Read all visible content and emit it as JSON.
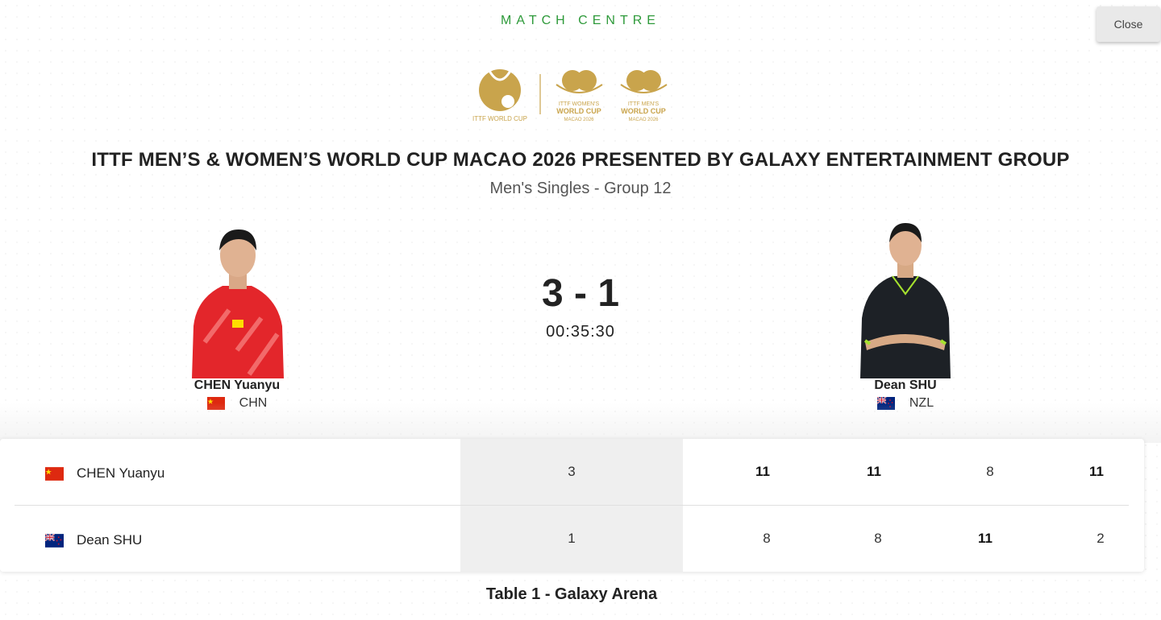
{
  "header": {
    "eyebrow": "MATCH CENTRE",
    "close_label": "Close"
  },
  "logos": {
    "logo1_text": "ITTF WORLD CUP",
    "logo2_text": [
      "ITTF WOMEN'S",
      "WORLD CUP",
      "MACAO 2026"
    ],
    "logo3_text": [
      "ITTF MEN'S",
      "WORLD CUP",
      "MACAO 2026"
    ],
    "gold": "#c9a44c"
  },
  "event": {
    "title": "ITTF MEN’S & WOMEN’S WORLD CUP MACAO 2026 PRESENTED BY GALAXY ENTERTAINMENT GROUP",
    "subtitle": "Men's Singles - Group 12"
  },
  "match": {
    "score": "3 - 1",
    "duration": "00:35:30"
  },
  "players": [
    {
      "name": "CHEN Yuanyu",
      "country": "CHN",
      "flag": "china-flag-icon",
      "jersey": "#e3262b"
    },
    {
      "name": "Dean SHU",
      "country": "NZL",
      "flag": "new-zealand-flag-icon",
      "jersey": "#1d2126"
    }
  ],
  "scoreboard": {
    "rows": [
      {
        "name": "CHEN Yuanyu",
        "games": "3",
        "sets": [
          "11",
          "11",
          "8",
          "11"
        ],
        "won": [
          true,
          true,
          false,
          true
        ]
      },
      {
        "name": "Dean SHU",
        "games": "1",
        "sets": [
          "8",
          "8",
          "11",
          "2"
        ],
        "won": [
          false,
          false,
          true,
          false
        ]
      }
    ]
  },
  "venue": "Table 1 - Galaxy Arena",
  "colors": {
    "accent": "#2e9a3a",
    "china_red": "#de2910",
    "china_yellow": "#ffde00",
    "nz_blue": "#00247d"
  }
}
